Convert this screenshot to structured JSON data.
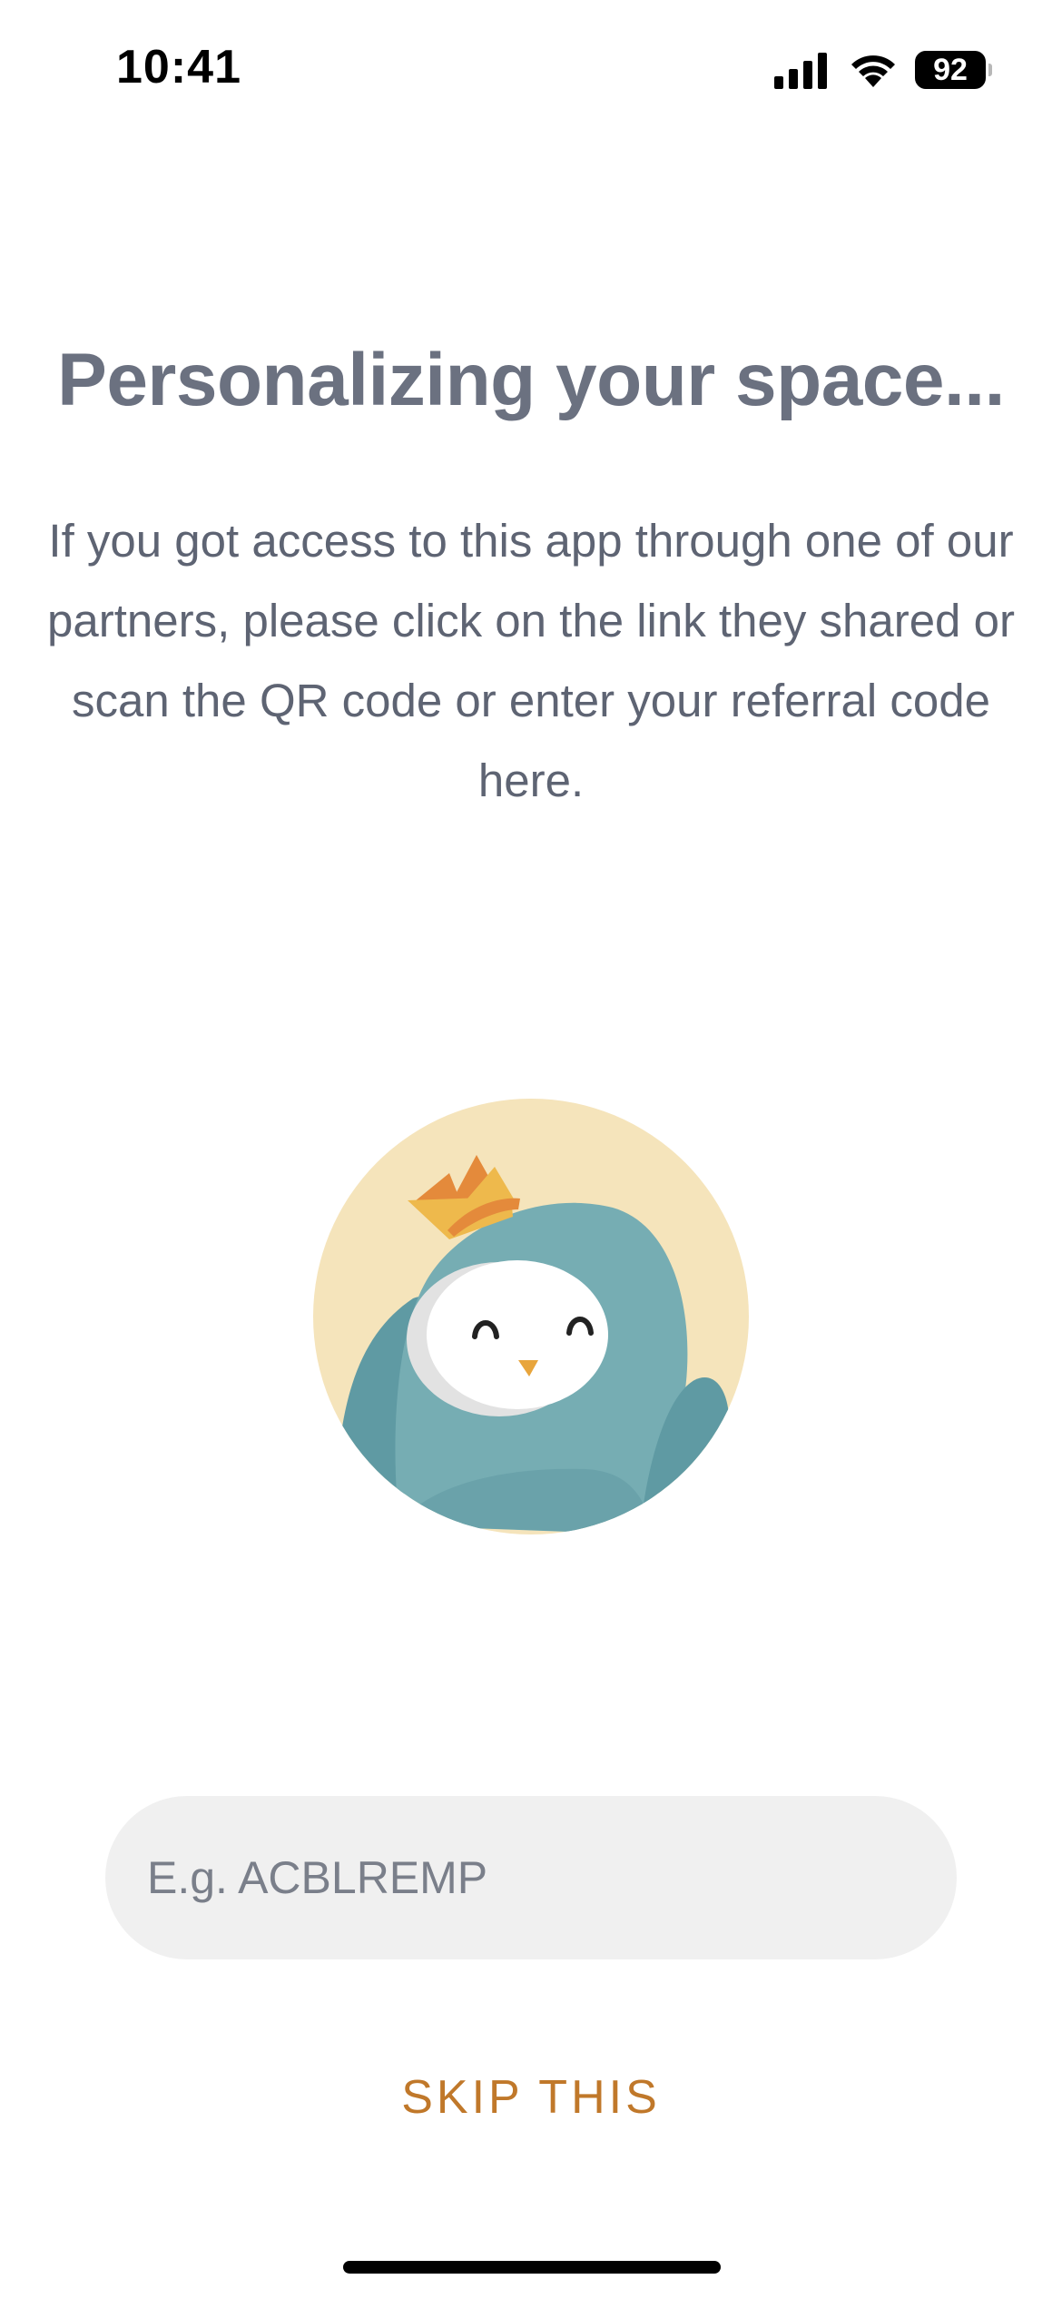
{
  "status_bar": {
    "time": "10:41",
    "battery_level": "92",
    "icons": [
      "signal-icon",
      "wifi-icon",
      "battery-icon"
    ]
  },
  "title": "Personalizing your space...",
  "description": "If you got access to this app through one of our partners, please click on the link they shared or scan the QR code or enter your referral code here.",
  "illustration": {
    "name": "penguin-mascot",
    "colors": {
      "background": "#f5e4bb",
      "body": "#76adb3",
      "flipper": "#5f9aa3",
      "face": "#ffffff",
      "crown_light": "#eeb94c",
      "crown_dark": "#e48a3b",
      "beak": "#e8a53c"
    }
  },
  "referral_input": {
    "value": "",
    "placeholder": "E.g. ACBLREMP"
  },
  "skip_button": {
    "label": "SKIP THIS"
  },
  "colors": {
    "title": "#6b7180",
    "text": "#5e6473",
    "accent": "#c0782a",
    "input_bg": "#f0f0f0"
  }
}
